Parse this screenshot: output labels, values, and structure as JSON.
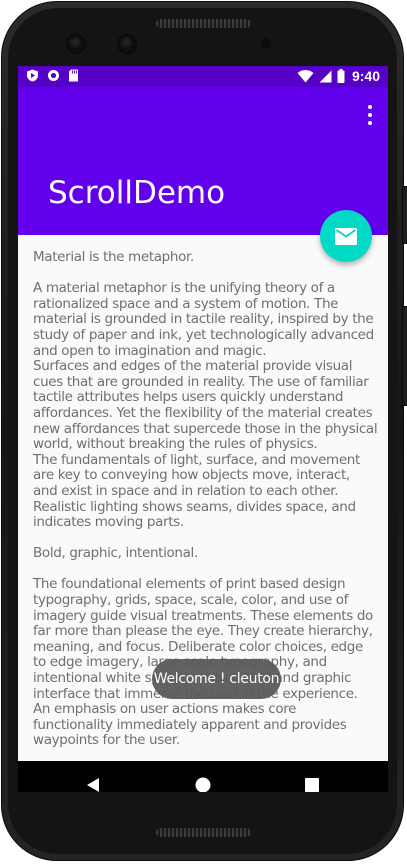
{
  "status_bar": {
    "time": "9:40",
    "left_icons": [
      "play-protect-icon",
      "sync-circle-icon",
      "sd-card-icon"
    ],
    "right_icons": [
      "wifi-icon",
      "cellular-signal-icon",
      "battery-icon"
    ]
  },
  "app_bar": {
    "title": "ScrollDemo",
    "menu_icon": "overflow-menu-icon",
    "color": "#6200ee",
    "status_color": "#5600c8"
  },
  "fab": {
    "icon": "email-icon",
    "color": "#03dac5"
  },
  "content": {
    "text": "Material is the metaphor.\n\n A material metaphor is the unifying theory of a rationalized space and a system of motion. The material is grounded in tactile reality, inspired by the study of paper and ink, yet  technologically advanced and open to imagination and magic.\n Surfaces and edges of the material provide visual cues that are grounded in reality. The  use of familiar tactile attributes helps users quickly understand affordances. Yet the  flexibility of the material creates new affordances that supercede those in the physical  world, without breaking the rules of physics.\n The fundamentals of light, surface, and movement are key to conveying how objects move,  interact, and exist in space and in relation to each other. Realistic lighting shows  seams, divides space, and indicates moving parts.\n\n Bold, graphic, intentional.\n\n The foundational elements of print based design typography, grids, space, scale, color,  and use of imagery guide visual treatments. These elements do far more than please the  eye. They create hierarchy, meaning, and focus. Deliberate color choices, edge to edge  imagery, large scale typography, and intentional white space create a bold and graphic interface that immerse the user in the experience.\n An emphasis on user actions makes core functionality immediately apparent and provides waypoints for the user."
  },
  "toast": {
    "text": "Welcome ! cleuton"
  },
  "nav_bar": {
    "icons": [
      "back-icon",
      "home-icon",
      "recents-icon"
    ]
  }
}
